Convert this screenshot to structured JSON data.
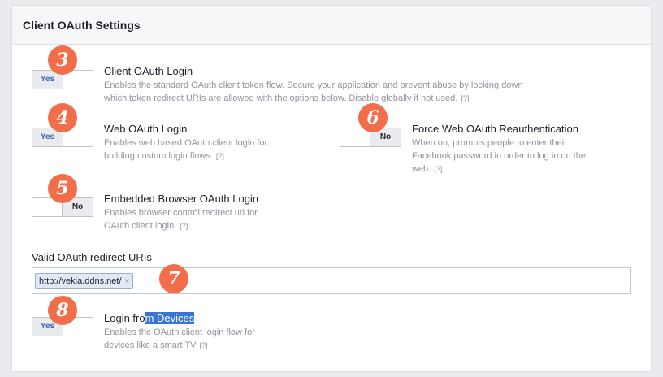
{
  "panel": {
    "title": "Client OAuth Settings"
  },
  "settings": {
    "client_oauth_login": {
      "toggle": "Yes",
      "title": "Client OAuth Login",
      "desc_line1": "Enables the standard OAuth client token flow. Secure your application and prevent abuse by locking down",
      "desc_line2": "which token redirect URIs are allowed with the options below. Disable globally if not used.",
      "help": "[?]"
    },
    "web_oauth_login": {
      "toggle": "Yes",
      "title": "Web OAuth Login",
      "desc_line1": "Enables web based OAuth client login for",
      "desc_line2": "building custom login flows.",
      "help": "[?]"
    },
    "force_web_reauth": {
      "toggle": "No",
      "title": "Force Web OAuth Reauthentication",
      "desc_line1": "When on, prompts people to enter their",
      "desc_line2": "Facebook password in order to log in on the",
      "desc_line3": "web.",
      "help": "[?]"
    },
    "embedded_browser": {
      "toggle": "No",
      "title": "Embedded Browser OAuth Login",
      "desc_line1": "Enables browser control redirect uri for",
      "desc_line2": "OAuth client login.",
      "help": "[?]"
    },
    "login_from_devices": {
      "toggle": "Yes",
      "title_part1": "Login fro",
      "title_part2": "m Devices",
      "desc_line1": "Enables the OAuth client login flow for",
      "desc_line2": "devices like a smart TV",
      "help": "[?]"
    }
  },
  "redirect_uris": {
    "label": "Valid OAuth redirect URIs",
    "tokens": [
      "http://vekia.ddns.net/"
    ],
    "remove": "×"
  },
  "badges": [
    "3",
    "4",
    "6",
    "5",
    "7",
    "8"
  ],
  "colors": {
    "badge": "#f26e4b",
    "accent": "#4267b2",
    "selection": "#3875d7"
  }
}
